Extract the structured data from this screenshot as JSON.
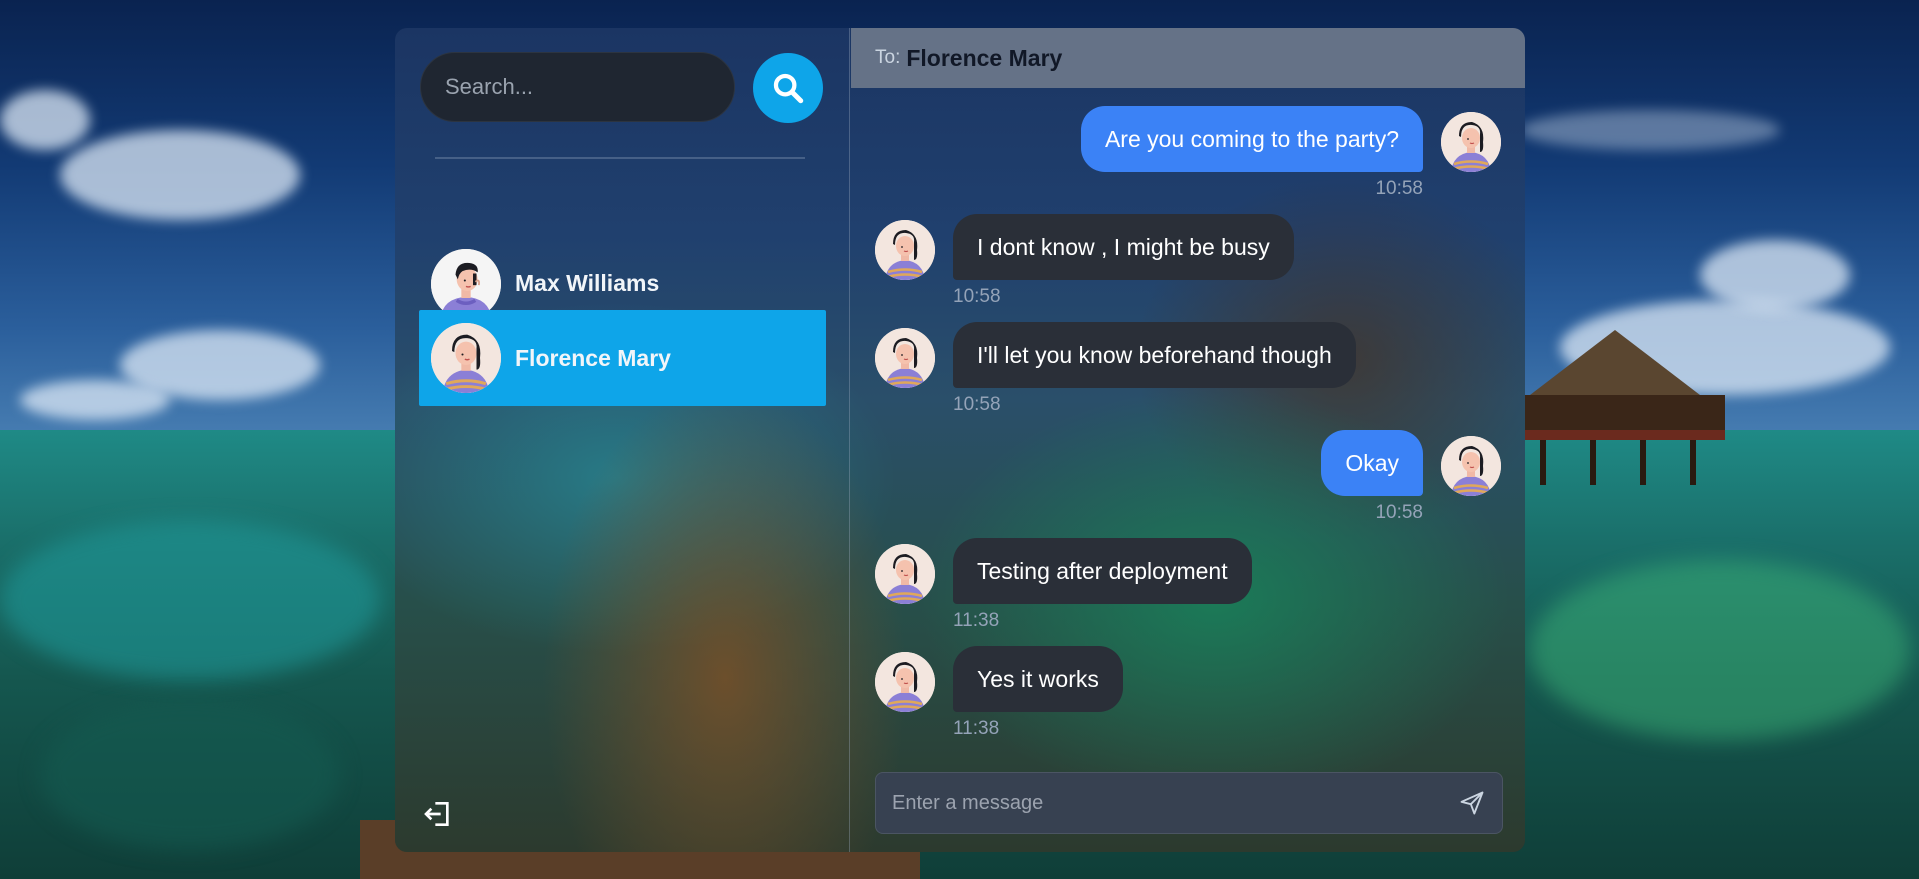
{
  "search": {
    "placeholder": "Search..."
  },
  "contacts": [
    {
      "name": "Max Williams",
      "active": false
    },
    {
      "name": "Florence Mary",
      "active": true
    }
  ],
  "header": {
    "to_label": "To:",
    "recipient": "Florence Mary"
  },
  "messages": [
    {
      "text": "Are you coming to the party?",
      "time": "10:58",
      "direction": "out"
    },
    {
      "text": "I dont know , I might be busy",
      "time": "10:58",
      "direction": "in"
    },
    {
      "text": "I'll let you know beforehand though",
      "time": "10:58",
      "direction": "in"
    },
    {
      "text": "Okay",
      "time": "10:58",
      "direction": "out"
    },
    {
      "text": "Testing after deployment",
      "time": "11:38",
      "direction": "in"
    },
    {
      "text": "Yes it works",
      "time": "11:38",
      "direction": "in"
    }
  ],
  "composer": {
    "placeholder": "Enter a message"
  },
  "icons": {
    "search": "search-icon",
    "logout": "logout-icon",
    "send": "send-icon"
  },
  "colors": {
    "accent": "#0ea5e9",
    "outgoing_bubble": "#3b82f6",
    "incoming_bubble": "#2a2f38",
    "header": "#657287"
  }
}
